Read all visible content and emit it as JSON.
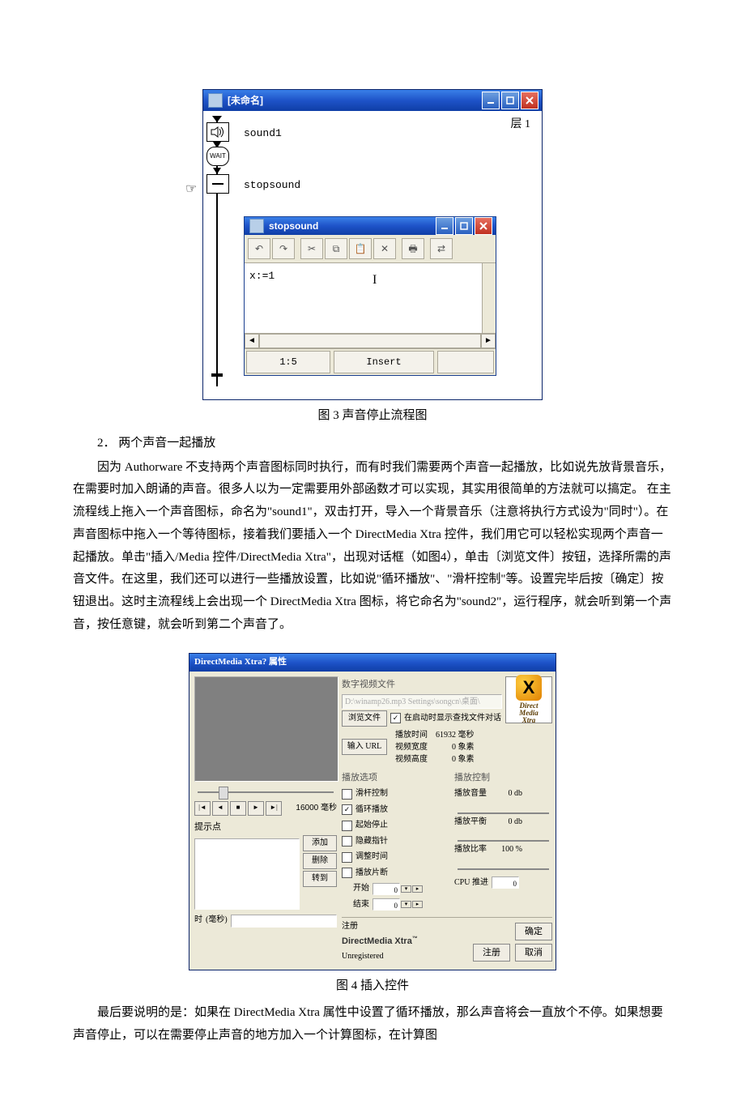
{
  "fig3": {
    "mainTitle": "[未命名]",
    "layerLabel": "层 1",
    "soundLabel": "sound1",
    "waitLabel": "WAIT",
    "calcLabel": "stopsound",
    "innerTitle": "stopsound",
    "code": "x:=1",
    "status_pos": "1:5",
    "status_mode": "Insert",
    "caption": "图 3 声音停止流程图"
  },
  "section2": {
    "heading": "2． 两个声音一起播放",
    "body": "因为 Authorware 不支持两个声音图标同时执行，而有时我们需要两个声音一起播放，比如说先放背景音乐，在需要时加入朗诵的声音。很多人以为一定需要用外部函数才可以实现，其实用很简单的方法就可以搞定。 在主流程线上拖入一个声音图标，命名为\"sound1\"，双击打开，导入一个背景音乐（注意将执行方式设为\"同时\"）。在声音图标中拖入一个等待图标，接着我们要插入一个 DirectMedia Xtra 控件，我们用它可以轻松实现两个声音一起播放。单击\"插入/Media 控件/DirectMedia Xtra\"，出现对话框（如图4），单击〔浏览文件〕按钮，选择所需的声音文件。在这里，我们还可以进行一些播放设置，比如说\"循环播放\"、\"滑杆控制\"等。设置完毕后按〔确定〕按钮退出。这时主流程线上会出现一个 DirectMedia Xtra 图标，将它命名为\"sound2\"，运行程序，就会听到第一个声音，按任意键，就会听到第二个声音了。"
  },
  "fig4": {
    "title": "DirectMedia Xtra? 属性",
    "fileGroup": "数字视频文件",
    "filePath": "D:\\winamp26.mp3 Settings\\songcn\\桌面\\",
    "browseBtn": "浏览文件",
    "inputUrlBtn": "输入 URL",
    "showDialogCheck": "在启动时显示查找文件对话",
    "stats": {
      "playTimeLabel": "播放时间",
      "playTimeVal": "61932 毫秒",
      "vidWidthLabel": "视频宽度",
      "vidWidthVal": "0 象素",
      "vidHeightLabel": "视频高度",
      "vidHeightVal": "0 象素"
    },
    "playOptionsTitle": "播放选项",
    "opts": {
      "slider": "滑杆控制",
      "loop": "循环播放",
      "pauseStart": "起始停止",
      "hideCursor": "隐藏指针",
      "adjustTime": "调整时间",
      "playSeg": "播放片断"
    },
    "segStartLabel": "开始",
    "segEndLabel": "结束",
    "segStartVal": "0",
    "segEndVal": "0",
    "ctrlTitle": "播放控制",
    "volumeLabel": "播放音量",
    "volumeVal": "0 db",
    "balanceLabel": "播放平衡",
    "balanceVal": "0 db",
    "rateLabel": "播放比率",
    "rateVal": "100 %",
    "cpuLabel": "CPU 推进",
    "cpuVal": "0",
    "transportMs": "16000 毫秒",
    "cueLabel": "提示点",
    "addBtn": "添加",
    "delBtn": "删除",
    "gotoBtn": "转到",
    "timeLabel": "时",
    "timeUnit": "(毫秒)",
    "regTitle": "注册",
    "brand": "DirectMedia Xtra",
    "tm": "™",
    "regStatus": "Unregistered",
    "regBtn": "注册",
    "okBtn": "确定",
    "cancelBtn": "取消",
    "logoText1": "Direct",
    "logoText2": "Media",
    "logoText3": "Xtra",
    "caption": "图 4 插入控件"
  },
  "finalPara": "最后要说明的是：如果在 DirectMedia Xtra 属性中设置了循环播放，那么声音将会一直放个不停。如果想要声音停止，可以在需要停止声音的地方加入一个计算图标，在计算图"
}
